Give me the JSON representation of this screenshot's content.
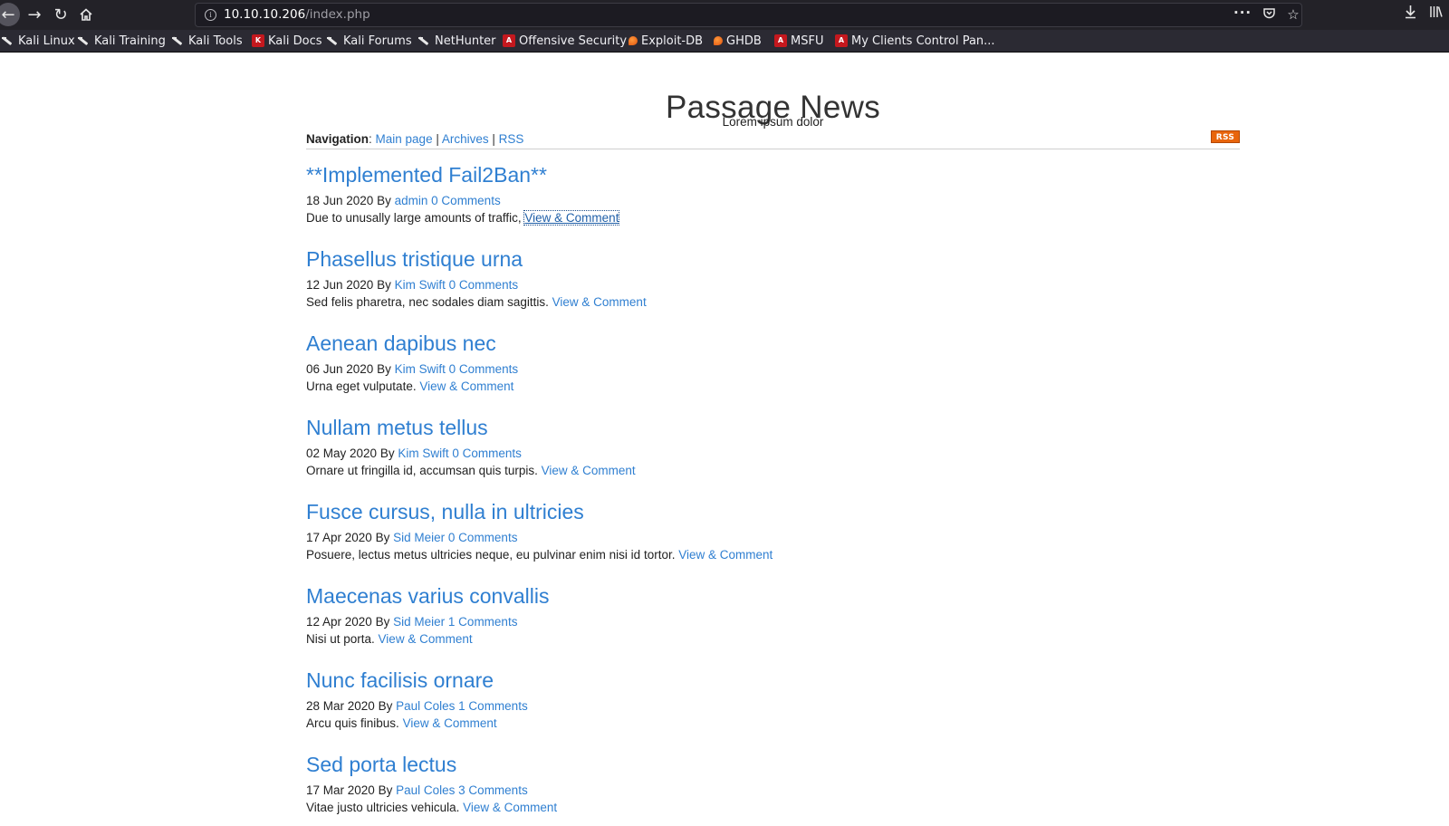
{
  "browser": {
    "url_host": "10.10.10.206",
    "url_path": "/index.php",
    "bookmarks": [
      {
        "label": "Kali Linux",
        "icon": "kali-dragon-icon"
      },
      {
        "label": "Kali Training",
        "icon": "kali-dragon-icon"
      },
      {
        "label": "Kali Tools",
        "icon": "kali-dragon-icon"
      },
      {
        "label": "Kali Docs",
        "icon": "kali-docs-icon"
      },
      {
        "label": "Kali Forums",
        "icon": "kali-dragon-icon"
      },
      {
        "label": "NetHunter",
        "icon": "kali-dragon-icon"
      },
      {
        "label": "Offensive Security",
        "icon": "offsec-icon"
      },
      {
        "label": "Exploit-DB",
        "icon": "exploitdb-icon"
      },
      {
        "label": "GHDB",
        "icon": "exploitdb-icon"
      },
      {
        "label": "MSFU",
        "icon": "offsec-icon"
      },
      {
        "label": "My Clients Control Pan...",
        "icon": "offsec-icon"
      }
    ],
    "more_label": "···"
  },
  "site": {
    "title": "Passage News",
    "subtitle": "Lorem ipsum dolor",
    "nav_label": "Navigation",
    "nav_links": [
      "Main page",
      "Archives",
      "RSS"
    ],
    "rss_badge": "RSS"
  },
  "posts": [
    {
      "title": "**Implemented Fail2Ban**",
      "date": "18 Jun 2020",
      "by": "By",
      "author": "admin",
      "comments": "0 Comments",
      "excerpt": "Due to unusally large amounts of traffic,",
      "link": "View & Comment"
    },
    {
      "title": "Phasellus tristique urna",
      "date": "12 Jun 2020",
      "by": "By",
      "author": "Kim Swift",
      "comments": "0 Comments",
      "excerpt": "Sed felis pharetra, nec sodales diam sagittis.",
      "link": "View & Comment"
    },
    {
      "title": "Aenean dapibus nec",
      "date": "06 Jun 2020",
      "by": "By",
      "author": "Kim Swift",
      "comments": "0 Comments",
      "excerpt": "Urna eget vulputate.",
      "link": "View & Comment"
    },
    {
      "title": "Nullam metus tellus",
      "date": "02 May 2020",
      "by": "By",
      "author": "Kim Swift",
      "comments": "0 Comments",
      "excerpt": "Ornare ut fringilla id, accumsan quis turpis.",
      "link": "View & Comment"
    },
    {
      "title": "Fusce cursus, nulla in ultricies",
      "date": "17 Apr 2020",
      "by": "By",
      "author": "Sid Meier",
      "comments": "0 Comments",
      "excerpt": "Posuere, lectus metus ultricies neque, eu pulvinar enim nisi id tortor.",
      "link": "View & Comment"
    },
    {
      "title": "Maecenas varius convallis",
      "date": "12 Apr 2020",
      "by": "By",
      "author": "Sid Meier",
      "comments": "1 Comments",
      "excerpt": "Nisi ut porta.",
      "link": "View & Comment"
    },
    {
      "title": "Nunc facilisis ornare",
      "date": "28 Mar 2020",
      "by": "By",
      "author": "Paul Coles",
      "comments": "1 Comments",
      "excerpt": "Arcu quis finibus.",
      "link": "View & Comment"
    },
    {
      "title": "Sed porta lectus",
      "date": "17 Mar 2020",
      "by": "By",
      "author": "Paul Coles",
      "comments": "3 Comments",
      "excerpt": "Vitae justo ultricies vehicula.",
      "link": "View & Comment"
    }
  ],
  "colors": {
    "link": "#2f7fd1",
    "rss": "#e8650c",
    "chrome": "#2b2a33"
  }
}
